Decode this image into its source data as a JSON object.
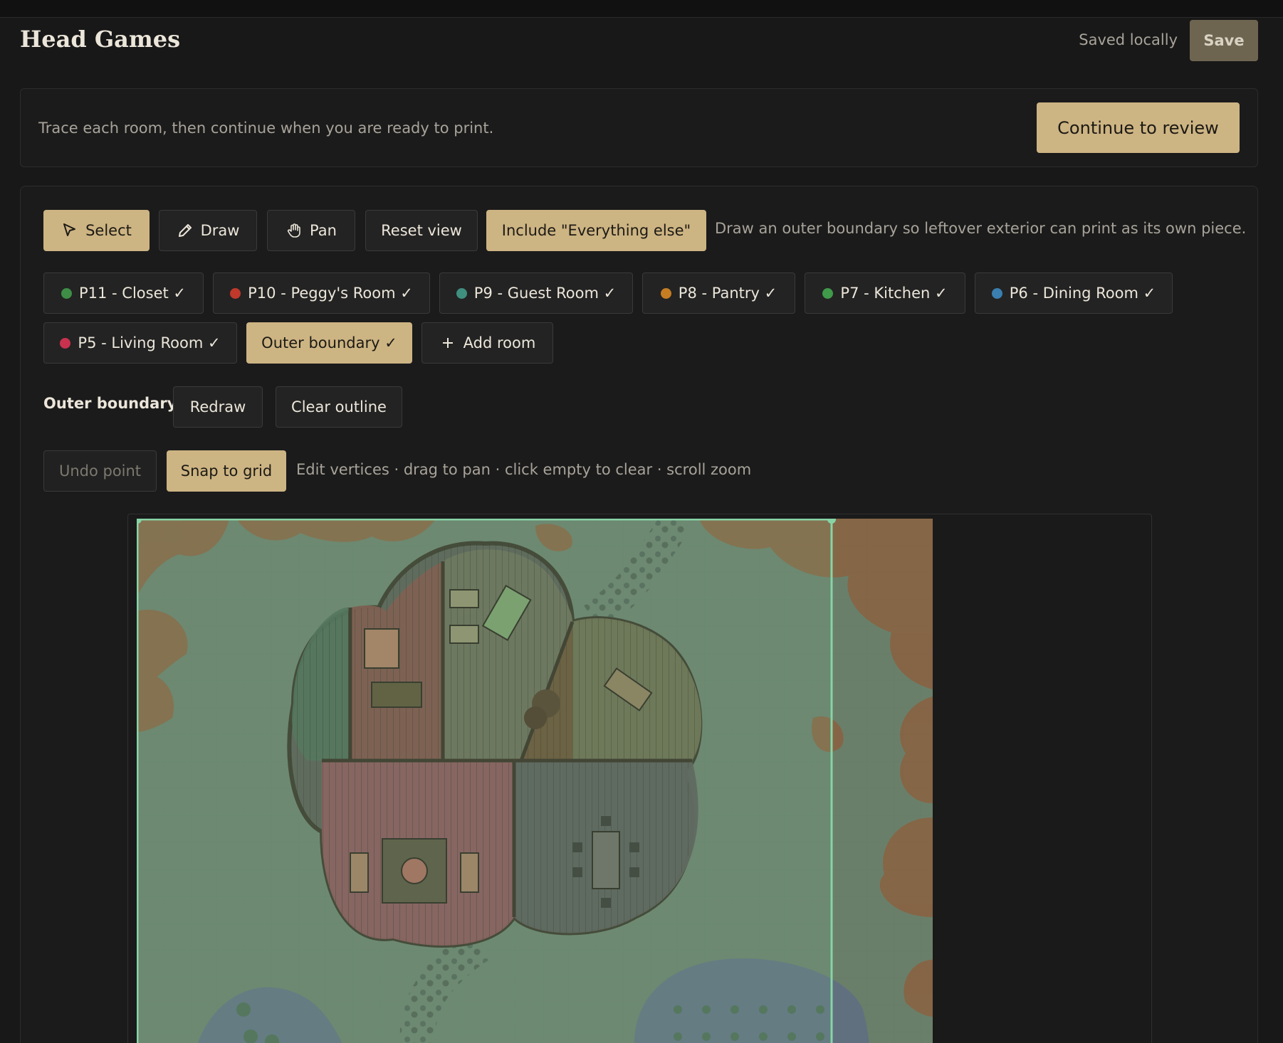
{
  "app": {
    "title": "Head Games",
    "saved_status": "Saved locally",
    "save_label": "Save"
  },
  "intro": {
    "text": "Trace each room, then continue when you are ready to print.",
    "continue_label": "Continue to review"
  },
  "toolbar": {
    "select_label": "Select",
    "draw_label": "Draw",
    "pan_label": "Pan",
    "reset_label": "Reset view",
    "include_label": "Include \"Everything else\"",
    "include_hint": "Draw an outer boundary so leftover exterior can print as its own piece."
  },
  "rooms": [
    {
      "label": "P11 - Closet ✓",
      "color": "#3e8e46"
    },
    {
      "label": "P10 - Peggy's Room ✓",
      "color": "#c0392b"
    },
    {
      "label": "P9 - Guest Room ✓",
      "color": "#3f8f7f"
    },
    {
      "label": "P8 - Pantry ✓",
      "color": "#c77d22"
    },
    {
      "label": "P7 - Kitchen ✓",
      "color": "#3f9a4a"
    },
    {
      "label": "P6 - Dining Room ✓",
      "color": "#3a7fb0"
    },
    {
      "label": "P5 - Living Room ✓",
      "color": "#c8324f"
    }
  ],
  "outer_boundary_chip": "Outer boundary ✓",
  "add_room_label": "Add room",
  "selection": {
    "name": "Outer boundary",
    "redraw_label": "Redraw",
    "clear_label": "Clear outline"
  },
  "edit": {
    "undo_label": "Undo point",
    "snap_label": "Snap to grid",
    "hint": "Edit vertices · drag to pan · click empty to clear · scroll zoom"
  },
  "colors": {
    "accent": "#cdb483",
    "boundary": "#86d4a6",
    "background": "#181818"
  }
}
